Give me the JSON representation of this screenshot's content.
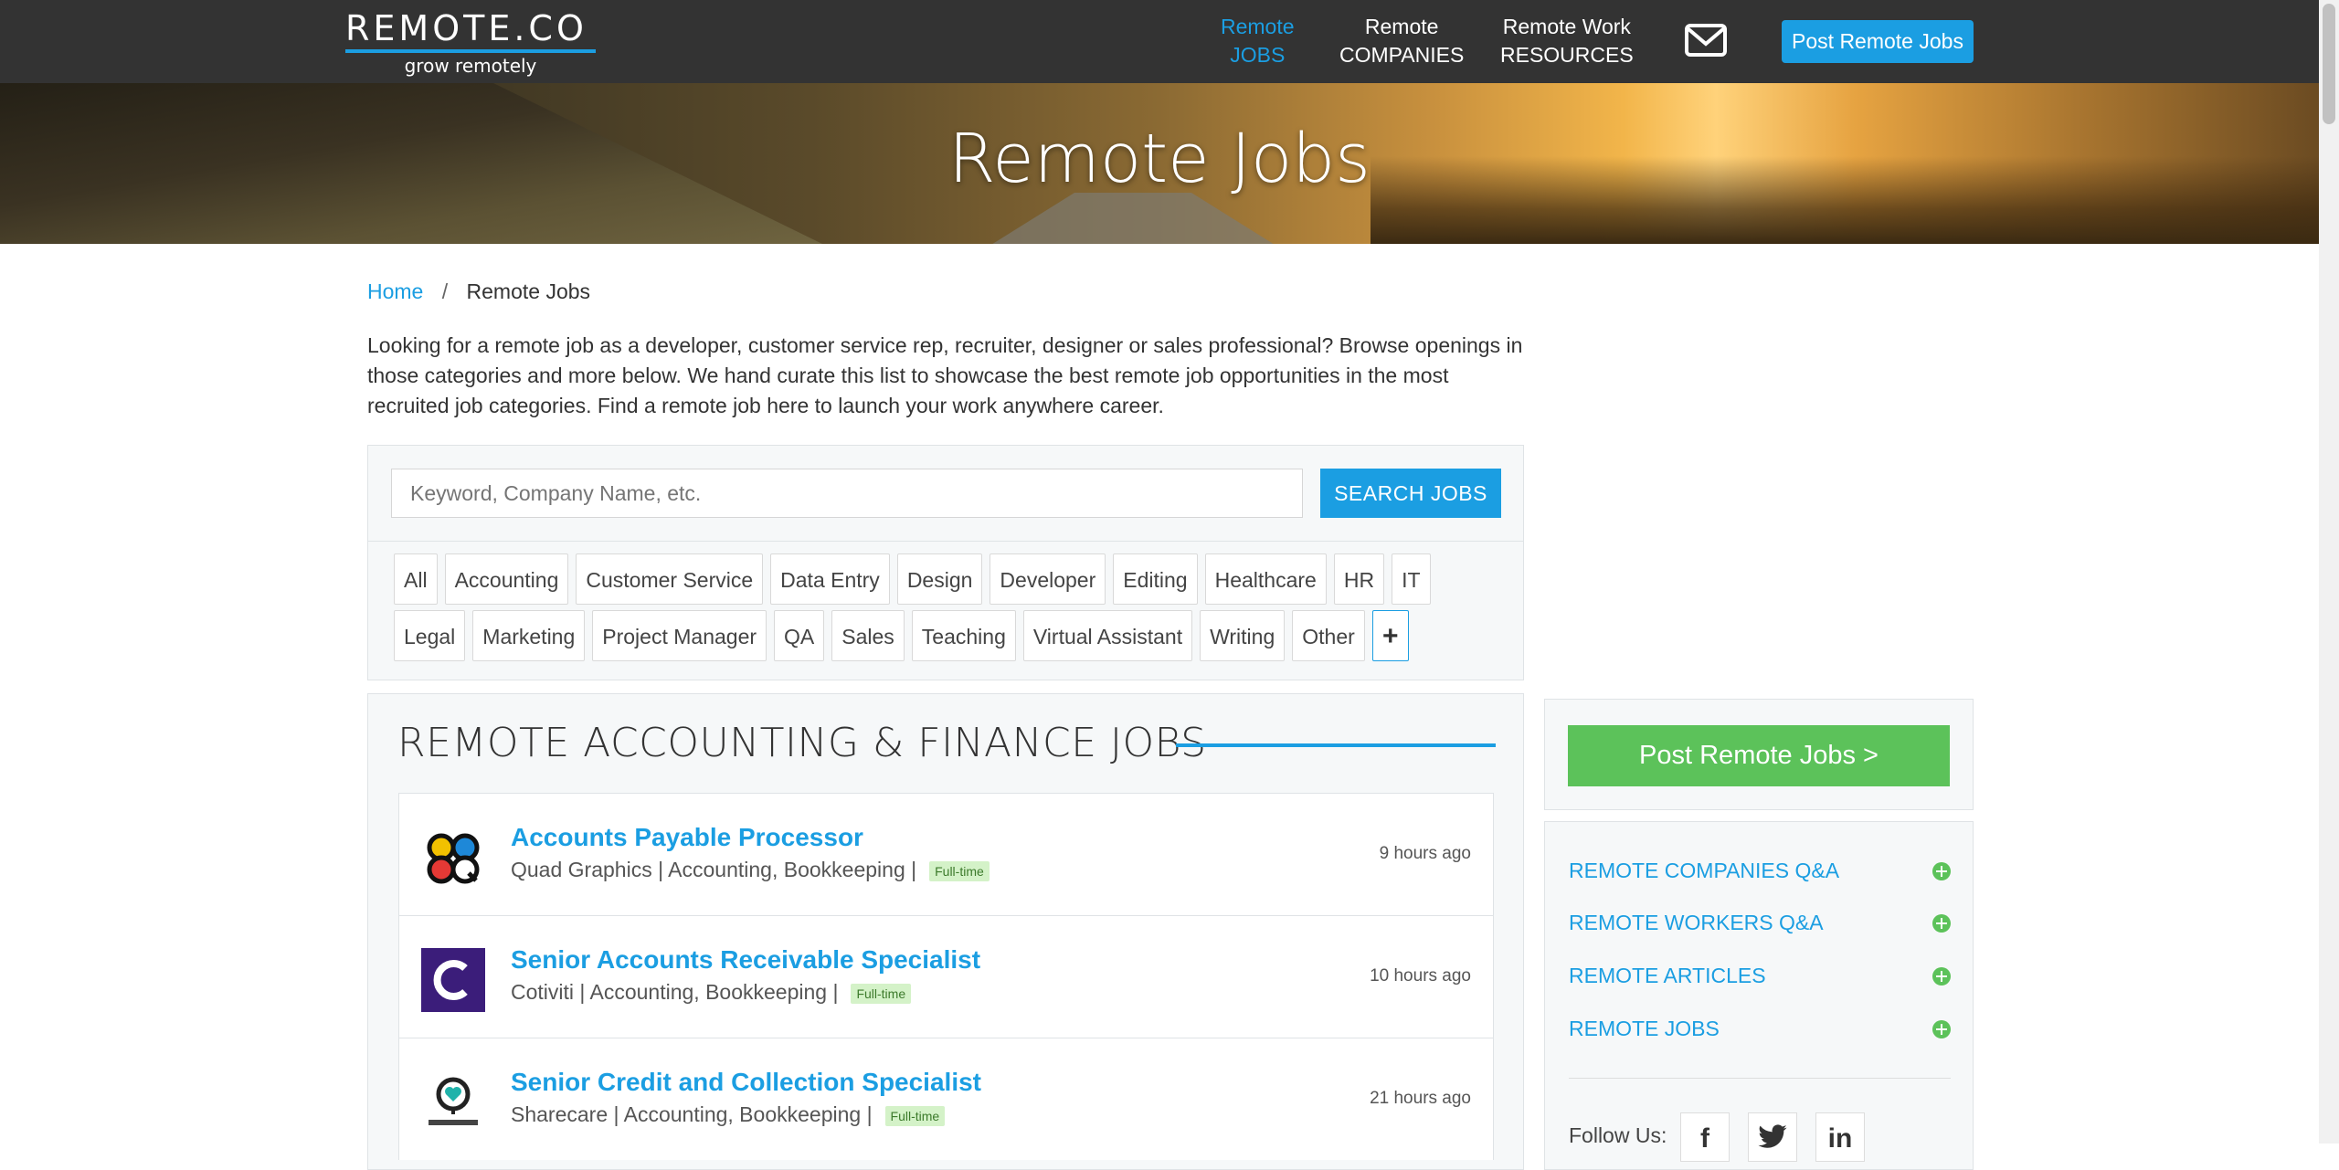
{
  "header": {
    "logo_text": "REMOTE.CO",
    "logo_tagline": "grow remotely",
    "nav": [
      {
        "line1": "Remote",
        "line2": "JOBS"
      },
      {
        "line1": "Remote",
        "line2": "COMPANIES"
      },
      {
        "line1": "Remote Work",
        "line2": "RESOURCES"
      }
    ],
    "mail_icon": "envelope-icon",
    "post_button": "Post Remote Jobs",
    "accent_color": "#1b9ee2"
  },
  "hero": {
    "title": "Remote Jobs"
  },
  "breadcrumb": {
    "home": "Home",
    "separator": "/",
    "current": "Remote Jobs"
  },
  "intro": "Looking for a remote job as a developer, customer service rep, recruiter, designer or sales professional? Browse openings in those categories and more below. We hand curate this list to showcase the best remote job opportunities in the most recruited job categories. Find a remote job here to launch your work anywhere career.",
  "search": {
    "placeholder": "Keyword, Company Name, etc.",
    "button": "SEARCH JOBS",
    "categories_row1": [
      "All",
      "Accounting",
      "Customer Service",
      "Data Entry",
      "Design",
      "Developer",
      "Editing",
      "Healthcare",
      "HR",
      "IT"
    ],
    "categories_row2": [
      "Legal",
      "Marketing",
      "Project Manager",
      "QA",
      "Sales",
      "Teaching",
      "Virtual Assistant",
      "Writing",
      "Other"
    ],
    "more_button": "+"
  },
  "listing": {
    "heading": "REMOTE ACCOUNTING & FINANCE JOBS",
    "jobs": [
      {
        "title": "Accounts Payable Processor",
        "meta": "Quad Graphics | Accounting, Bookkeeping  |",
        "badge": "Full-time",
        "time": "9 hours ago"
      },
      {
        "title": "Senior Accounts Receivable Specialist",
        "meta": "Cotiviti | Accounting, Bookkeeping  |",
        "badge": "Full-time",
        "time": "10 hours ago"
      },
      {
        "title": "Senior Credit and Collection Specialist",
        "meta": "Sharecare | Accounting, Bookkeeping  |",
        "badge": "Full-time",
        "time": "21 hours ago"
      }
    ]
  },
  "sidebar": {
    "post_button": "Post Remote Jobs >",
    "post_color": "#5cc25a",
    "links": [
      "REMOTE COMPANIES Q&A",
      "REMOTE WORKERS Q&A",
      "REMOTE ARTICLES",
      "REMOTE JOBS"
    ],
    "follow_label": "Follow Us:",
    "social": [
      "facebook-icon",
      "twitter-icon",
      "linkedin-icon"
    ]
  }
}
